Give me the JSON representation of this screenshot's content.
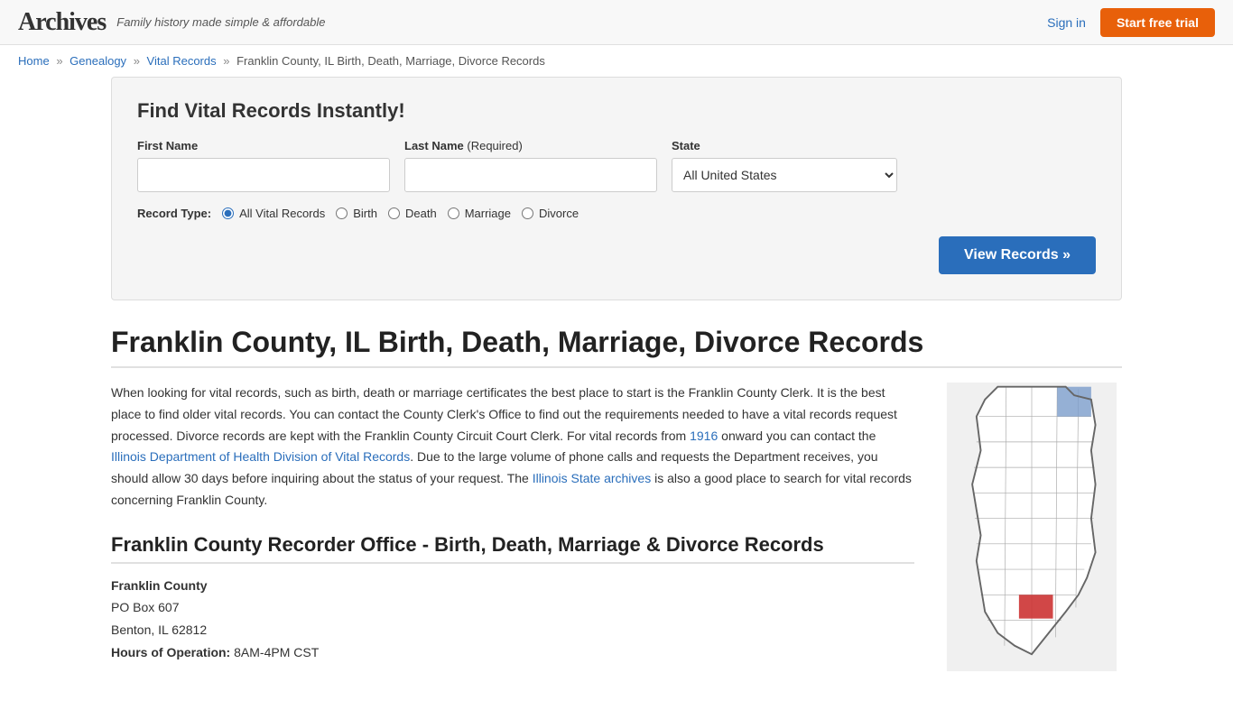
{
  "header": {
    "logo": "Archives",
    "tagline": "Family history made simple & affordable",
    "signin_label": "Sign in",
    "trial_label": "Start free trial"
  },
  "breadcrumb": {
    "home": "Home",
    "genealogy": "Genealogy",
    "vital_records": "Vital Records",
    "current": "Franklin County, IL Birth, Death, Marriage, Divorce Records"
  },
  "search": {
    "title": "Find Vital Records Instantly!",
    "first_name_label": "First Name",
    "last_name_label": "Last Name",
    "last_name_required": "(Required)",
    "state_label": "State",
    "state_default": "All United States",
    "record_type_label": "Record Type:",
    "record_types": [
      "All Vital Records",
      "Birth",
      "Death",
      "Marriage",
      "Divorce"
    ],
    "view_records_label": "View Records »"
  },
  "page": {
    "title": "Franklin County, IL Birth, Death, Marriage, Divorce Records",
    "body_text": "When looking for vital records, such as birth, death or marriage certificates the best place to start is the Franklin County Clerk. It is the best place to find older vital records. You can contact the County Clerk's Office to find out the requirements needed to have a vital records request processed. Divorce records are kept with the Franklin County Circuit Court Clerk. For vital records from 1916 onward you can contact the Illinois Department of Health Division of Vital Records. Due to the large volume of phone calls and requests the Department receives, you should allow 30 days before inquiring about the status of your request. The Illinois State archives is also a good place to search for vital records concerning Franklin County.",
    "body_link1_text": "1916",
    "body_link2_text": "Illinois Department of Health Division of Vital Records",
    "body_link3_text": "Illinois State archives",
    "recorder_title": "Franklin County Recorder Office - Birth, Death, Marriage & Divorce Records",
    "office_name": "Franklin County",
    "address_line1": "PO Box 607",
    "address_line2": "Benton, IL 62812",
    "hours_label": "Hours of Operation:",
    "hours_value": "8AM-4PM CST"
  }
}
